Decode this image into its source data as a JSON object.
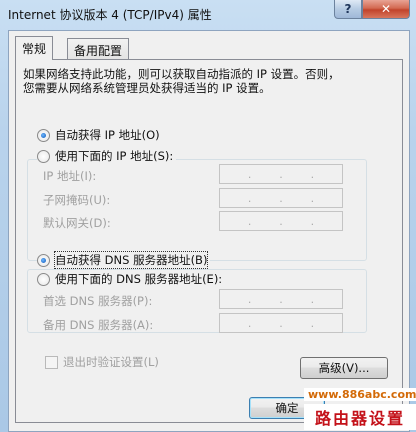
{
  "window": {
    "title": "Internet 协议版本 4 (TCP/IPv4) 属性",
    "help_glyph": "?",
    "close_glyph": "✕"
  },
  "tabs": [
    {
      "label": "常规",
      "active": true
    },
    {
      "label": "备用配置",
      "active": false
    }
  ],
  "description": {
    "line1": "如果网络支持此功能，则可以获取自动指派的 IP 设置。否则，",
    "line2": "您需要从网络系统管理员处获得适当的 IP 设置。"
  },
  "ip_section": {
    "auto_label": "自动获得 IP 地址(O)",
    "auto_selected": true,
    "manual_label": "使用下面的 IP 地址(S):",
    "fields": [
      {
        "label": "IP 地址(I):",
        "value": ""
      },
      {
        "label": "子网掩码(U):",
        "value": ""
      },
      {
        "label": "默认网关(D):",
        "value": ""
      }
    ]
  },
  "dns_section": {
    "auto_label": "自动获得 DNS 服务器地址(B)",
    "auto_selected": true,
    "manual_label": "使用下面的 DNS 服务器地址(E):",
    "fields": [
      {
        "label": "首选 DNS 服务器(P):",
        "value": ""
      },
      {
        "label": "备用 DNS 服务器(A):",
        "value": ""
      }
    ]
  },
  "validate_checkbox": {
    "label": "退出时验证设置(L)",
    "checked": false,
    "enabled": false
  },
  "buttons": {
    "advanced": "高级(V)...",
    "ok": "确定"
  },
  "watermark": {
    "url": "www.886abc.com",
    "text": "路由器设置"
  },
  "colors": {
    "accent": "#3c7fb1",
    "close": "#c1432b",
    "watermark_url": "#d36a08",
    "watermark_text": "#c4121a"
  }
}
